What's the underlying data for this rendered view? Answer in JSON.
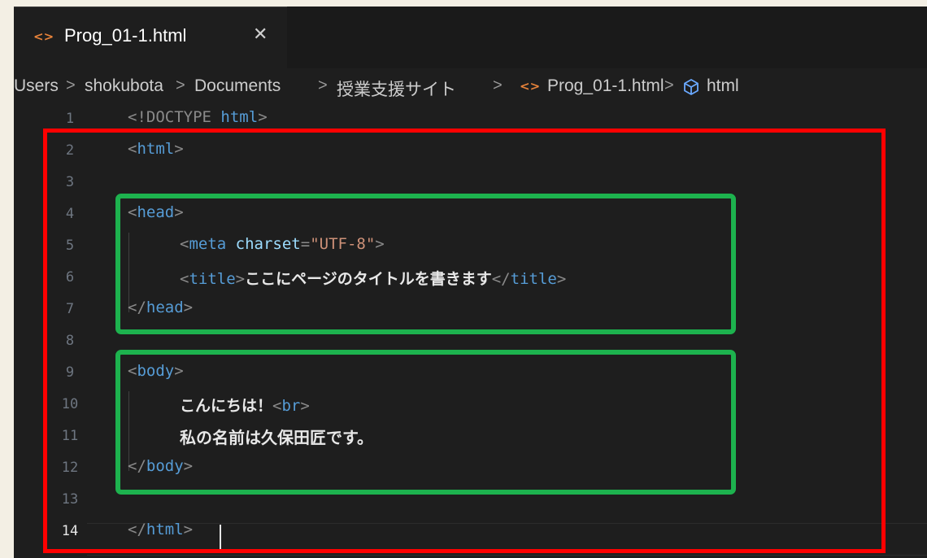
{
  "tab": {
    "label": "Prog_01-1.html",
    "icon": "html-file-icon",
    "close_icon": "close-icon"
  },
  "breadcrumb": {
    "items": [
      "Users",
      "shokubota",
      "Documents",
      "授業支援サイト",
      "Prog_01-1.html",
      "html"
    ],
    "separator": ">"
  },
  "code": {
    "lines": [
      {
        "n": "1",
        "text": "<!DOCTYPE html>"
      },
      {
        "n": "2",
        "text": "<html>"
      },
      {
        "n": "3",
        "text": ""
      },
      {
        "n": "4",
        "text": "<head>"
      },
      {
        "n": "5",
        "text": "<meta charset=\"UTF-8\">"
      },
      {
        "n": "6",
        "text": "<title>ここにページのタイトルを書きます</title>"
      },
      {
        "n": "7",
        "text": "</head>"
      },
      {
        "n": "8",
        "text": ""
      },
      {
        "n": "9",
        "text": "<body>"
      },
      {
        "n": "10",
        "text": "こんにちは！<br>"
      },
      {
        "n": "11",
        "text": "私の名前は久保田匠です。"
      },
      {
        "n": "12",
        "text": "</body>"
      },
      {
        "n": "13",
        "text": ""
      },
      {
        "n": "14",
        "text": "</html>"
      }
    ],
    "active_line": "14"
  },
  "colors": {
    "editor_bg": "#1e1e1e",
    "tag": "#569cd6",
    "attribute": "#9cdcfe",
    "string": "#ce9178",
    "annotation_red": "#ff0000",
    "annotation_green": "#1db24e",
    "file_icon": "#e8833a"
  }
}
